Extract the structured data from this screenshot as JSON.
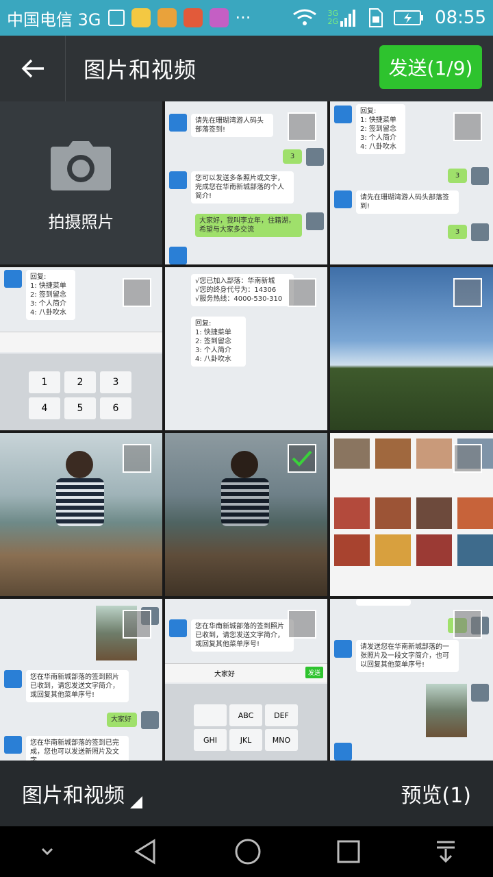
{
  "status": {
    "carrier": "中国电信 3G",
    "network": "3G",
    "network2": "2G",
    "time": "08:55",
    "overflow": "···"
  },
  "header": {
    "title": "图片和视频",
    "send_label": "发送(1/9)"
  },
  "camera": {
    "label": "拍摄照片"
  },
  "chat": {
    "prompt1": "请先在珊瑚湾游人码头部落签到!",
    "num3": "3",
    "intro_prompt": "您可以发送多条照片或文字，完成您在华南新城部落的个人简介!",
    "greeting": "大家好，我叫李立年，住籍湖，希望与大家多交流",
    "menu": "回复:\n1: 快捷菜单\n2: 签到留念\n3: 个人简介\n4: 八卦吹水",
    "joined": "√您已加入部落：华南新城\n√您的终身代号为：14306\n√服务热线：4000-530-310",
    "hotline": "4000-530-310",
    "checkin_done": "您在华南新城部落的签到照片已收到，请您发送文字简介，或回复其他菜单序号!",
    "hello": "大家好",
    "send_photo": "请发送您在华南新城部落的一张照片及一段文字简介，也可以回复其他菜单序号!",
    "checkin_done2": "您在华南新城部落的签到已完成，您也可以发送新照片及文字"
  },
  "keyboard": {
    "keys": [
      "1",
      "2",
      "3",
      "4",
      "5",
      "6"
    ],
    "t9": [
      "ABC",
      "DEF",
      "GHI",
      "JKL",
      "MNO"
    ],
    "input_text": "大家好",
    "send": "发送"
  },
  "bottom": {
    "album_label": "图片和视频",
    "preview_label": "预览(1)"
  },
  "colors": {
    "status_bg": "#3aa7bf",
    "title_bg": "#2f3336",
    "accent_green": "#2ec32e"
  }
}
